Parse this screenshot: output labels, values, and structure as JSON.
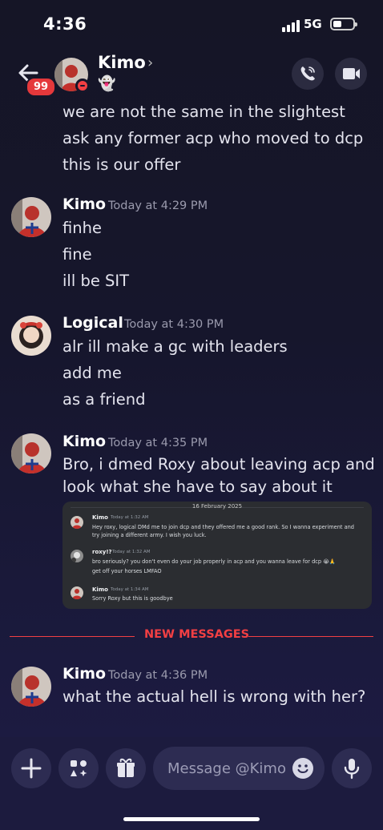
{
  "status_bar": {
    "time": "4:36",
    "network": "5G"
  },
  "header": {
    "unread_badge": "99",
    "name": "Kimo",
    "chevron": "›",
    "status_emoji": "👻"
  },
  "messages": {
    "prev_lines": [
      "we are not the same in the slightest",
      "ask any former acp who moved to dcp",
      "this is our offer"
    ],
    "group1": {
      "author": "Kimo",
      "time": "Today at 4:29 PM",
      "lines": [
        "finhe",
        "fine",
        "ill be SIT"
      ]
    },
    "group2": {
      "author": "Logical",
      "time": "Today at 4:30 PM",
      "lines": [
        "alr ill make a gc with leaders",
        "add me",
        "as a friend"
      ]
    },
    "group3": {
      "author": "Kimo",
      "time": "Today at 4:35 PM",
      "lines": [
        "Bro, i dmed Roxy about leaving acp and",
        "look what she have to say about it"
      ],
      "embed": {
        "date": "16 February 2025",
        "m1": {
          "author": "Kimo",
          "time": "Today at 1:32 AM",
          "lines": [
            "Hey roxy, logical DMd me to join dcp and they offered me a good rank. So I wanna experiment and",
            "try joining a different army. I wish you luck."
          ]
        },
        "m2": {
          "author": "roxy!?",
          "time": "Today at 1:32 AM",
          "lines": [
            "bro seriously? you don't even do your job properly in acp and you wanna leave for dcp 😭🙏",
            "get off your horses LMFAO"
          ]
        },
        "m3": {
          "author": "Kimo",
          "time": "Today at 1:34 AM",
          "lines": [
            "Sorry Roxy but this is goodbye"
          ]
        }
      }
    },
    "new_messages_label": "NEW MESSAGES",
    "group4": {
      "author": "Kimo",
      "time": "Today at 4:36 PM",
      "lines": [
        "what the actual hell is wrong with her?"
      ]
    }
  },
  "input": {
    "placeholder": "Message @Kimo"
  },
  "icons": [
    "back-arrow-icon",
    "phone-icon",
    "video-camera-icon",
    "plus-icon",
    "apps-icon",
    "gift-icon",
    "emoji-icon",
    "microphone-icon"
  ],
  "colors": {
    "accent_red": "#f23f43",
    "background": "#16162a",
    "input_bar": "#1c1b3e"
  }
}
